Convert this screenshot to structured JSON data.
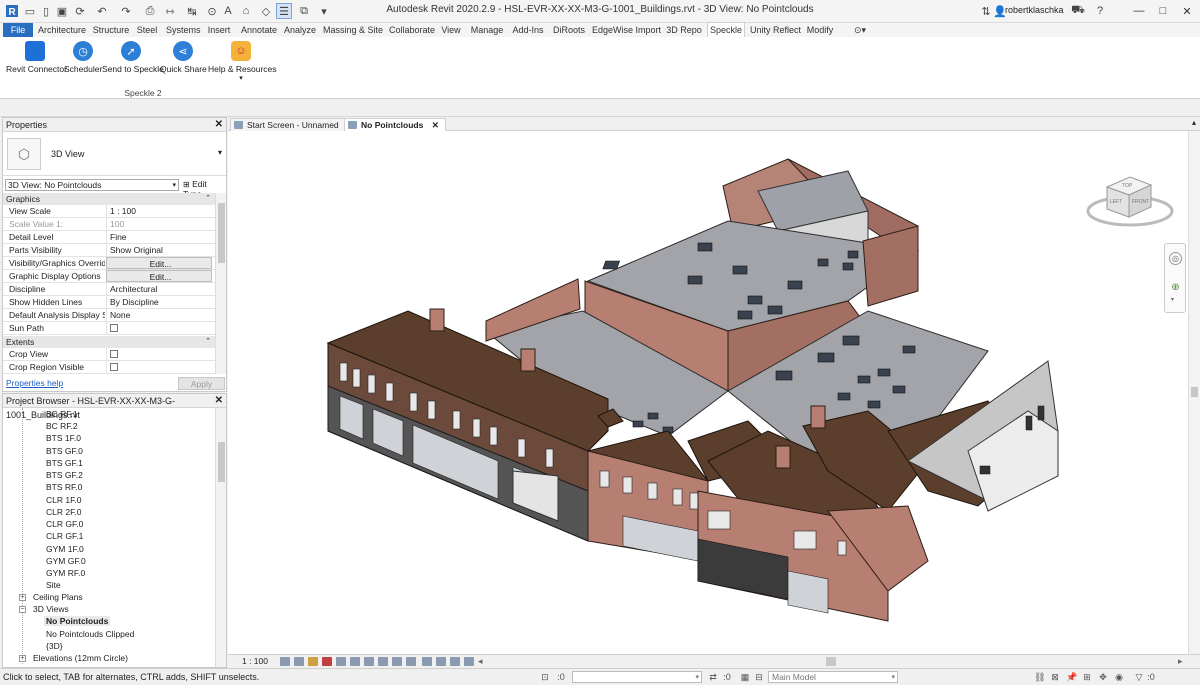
{
  "title_bar": {
    "title": "Autodesk Revit 2020.2.9 -  HSL-EVR-XX-XX-M3-G-1001_Buildings.rvt - 3D View: No Pointclouds",
    "user": "robertklaschka",
    "window_controls": [
      "—",
      "□",
      "✕"
    ]
  },
  "ribbon_tabs": [
    "File",
    "Architecture",
    "Structure",
    "Steel",
    "Systems",
    "Insert",
    "Annotate",
    "Analyze",
    "Massing & Site",
    "Collaborate",
    "View",
    "Manage",
    "Add-Ins",
    "DiRoots",
    "EdgeWise Import",
    "3D Repo",
    "Speckle",
    "Unity Reflect",
    "Modify"
  ],
  "active_tab": "Speckle",
  "ribbon_buttons": [
    {
      "label": "Revit Connector",
      "icon": "speckle-cube-icon"
    },
    {
      "label": "Scheduler",
      "icon": "clock-icon"
    },
    {
      "label": "Send to Speckle",
      "icon": "send-icon"
    },
    {
      "label": "Quick Share",
      "icon": "share-icon"
    },
    {
      "label": "Help & Resources",
      "icon": "help-person-icon"
    }
  ],
  "ribbon_panel_label": "Speckle 2",
  "properties": {
    "header": "Properties",
    "type_name": "3D View",
    "view_selector": "3D View: No Pointclouds",
    "edit_type": "Edit Type",
    "groups": {
      "graphics": "Graphics",
      "extents": "Extents"
    },
    "rows": [
      {
        "key": "View Scale",
        "value": "1 : 100"
      },
      {
        "key": "Scale Value    1:",
        "value": "100",
        "dim": true
      },
      {
        "key": "Detail Level",
        "value": "Fine"
      },
      {
        "key": "Parts Visibility",
        "value": "Show Original"
      },
      {
        "key": "Visibility/Graphics Overrid...",
        "value": "Edit...",
        "button": true
      },
      {
        "key": "Graphic Display Options",
        "value": "Edit...",
        "button": true
      },
      {
        "key": "Discipline",
        "value": "Architectural"
      },
      {
        "key": "Show Hidden Lines",
        "value": "By Discipline"
      },
      {
        "key": "Default Analysis Display S...",
        "value": "None"
      },
      {
        "key": "Sun Path",
        "value": ""
      }
    ],
    "extent_rows": [
      {
        "key": "Crop View",
        "value": ""
      },
      {
        "key": "Crop Region Visible",
        "value": ""
      }
    ],
    "help_link": "Properties help",
    "apply": "Apply"
  },
  "project_browser": {
    "header": "Project Browser - HSL-EVR-XX-XX-M3-G-1001_Buildings.rvt",
    "levels": [
      "BC RF.1",
      "BC RF.2",
      "BTS 1F.0",
      "BTS GF.0",
      "BTS GF.1",
      "BTS GF.2",
      "BTS RF.0",
      "CLR 1F.0",
      "CLR 2F.0",
      "CLR GF.0",
      "CLR GF.1",
      "GYM 1F.0",
      "GYM GF.0",
      "GYM RF.0",
      "Site"
    ],
    "ceiling_plans": "Ceiling Plans",
    "views_3d": "3D Views",
    "views_3d_items": [
      "No Pointclouds",
      "No Pointclouds Clipped",
      "{3D}"
    ],
    "elevations": "Elevations (12mm Circle)"
  },
  "view_tabs": [
    {
      "label": "Start Screen - Unnamed",
      "active": false
    },
    {
      "label": "No Pointclouds",
      "active": true
    }
  ],
  "view_control": {
    "scale": "1 : 100"
  },
  "viewcube": {
    "top": "TOP",
    "left": "LEFT",
    "front": "FRONT"
  },
  "status": {
    "message": "Click to select, TAB for alternates, CTRL adds, SHIFT unselects.",
    "workset_value": ":0",
    "model": "Main Model"
  },
  "colors": {
    "file_tab": "#2a6fbf",
    "speckle_blue": "#2d7fd8",
    "roof_brown": "#5b3f2c",
    "brick": "#b77e72",
    "flat_roof": "#a2a4aa"
  }
}
